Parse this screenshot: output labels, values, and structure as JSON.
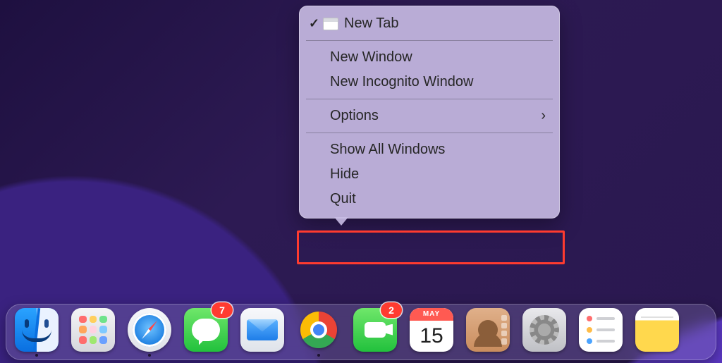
{
  "menu": {
    "new_tab": "New Tab",
    "new_window": "New Window",
    "new_incognito": "New Incognito Window",
    "options": "Options",
    "show_all": "Show All Windows",
    "hide": "Hide",
    "quit": "Quit"
  },
  "calendar": {
    "month": "MAY",
    "day": "15"
  },
  "badges": {
    "messages": "7",
    "facetime": "2"
  }
}
